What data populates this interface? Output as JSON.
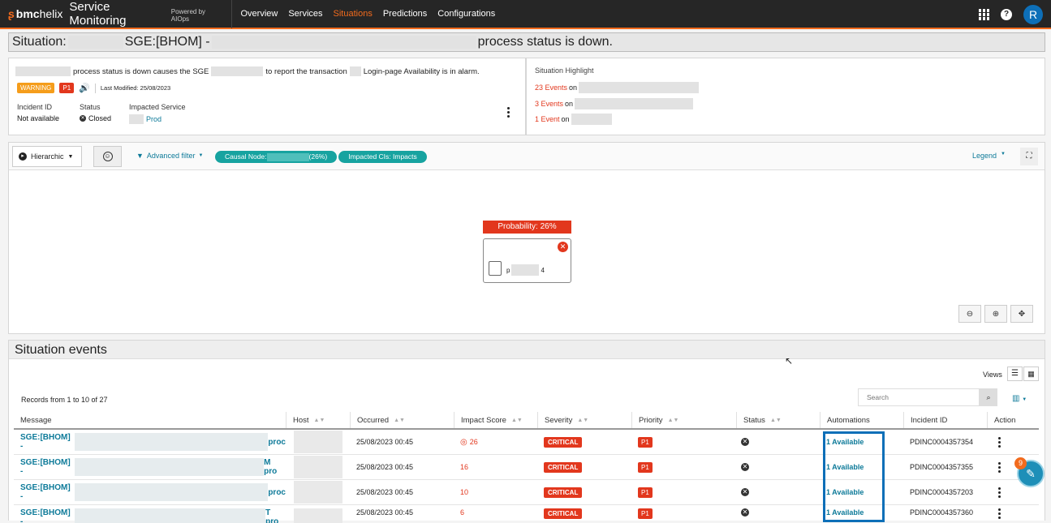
{
  "nav": {
    "brand_logo": "bmc",
    "brand_name": "helix",
    "product": "Service Monitoring",
    "powered": "Powered by AIOps",
    "items": [
      "Overview",
      "Services",
      "Situations",
      "Predictions",
      "Configurations"
    ],
    "active": "Situations",
    "avatar_initial": "R",
    "help": "?"
  },
  "situation": {
    "title_prefix": "Situation:",
    "title_mid": "SGE:[BHOM] -",
    "title_suffix": "process status is down.",
    "description_a": "process status is down causes the SGE",
    "description_b": "to report the transaction",
    "description_c": "Login-page Availability is in alarm.",
    "severity": "WARNING",
    "priority": "P1",
    "last_modified": "Last Modified: 25/08/2023",
    "incident_id_label": "Incident ID",
    "incident_id_value": "Not available",
    "status_label": "Status",
    "status_value": "Closed",
    "impacted_label": "Impacted Service",
    "impacted_value": "Prod"
  },
  "highlight": {
    "title": "Situation Highlight",
    "items": [
      {
        "count": "23 Events",
        "suffix": "on"
      },
      {
        "count": "3 Events",
        "suffix": "on"
      },
      {
        "count": "1 Event",
        "suffix": "on"
      }
    ]
  },
  "graph": {
    "view": "Hierarchic",
    "filter": "Advanced filter",
    "chip1_a": "Causal Node:",
    "chip1_b": "(26%)",
    "chip2": "Impacted CIs: Impacts",
    "legend": "Legend",
    "probability": "Probability: 26%",
    "node_a": "p",
    "node_b": "4"
  },
  "events": {
    "title": "Situation events",
    "views_label": "Views",
    "records": "Records from 1 to 10 of 27",
    "search_placeholder": "Search",
    "columns": [
      "Message",
      "Host",
      "Occurred",
      "Impact Score",
      "Severity",
      "Priority",
      "Status",
      "Automations",
      "Incident ID",
      "Action"
    ],
    "rows": [
      {
        "msg": "SGE:[BHOM] -",
        "msg_tail": "proc",
        "occurred": "25/08/2023 00:45",
        "score": "26",
        "severity": "CRITICAL",
        "priority": "P1",
        "automation": "1 Available",
        "incident": "PDINC0004357354"
      },
      {
        "msg": "SGE:[BHOM] -",
        "msg_tail": "M pro",
        "occurred": "25/08/2023 00:45",
        "score": "16",
        "severity": "CRITICAL",
        "priority": "P1",
        "automation": "1 Available",
        "incident": "PDINC0004357355"
      },
      {
        "msg": "SGE:[BHOM] -",
        "msg_tail": "proc",
        "occurred": "25/08/2023 00:45",
        "score": "10",
        "severity": "CRITICAL",
        "priority": "P1",
        "automation": "1 Available",
        "incident": "PDINC0004357203"
      },
      {
        "msg": "SGE:[BHOM] -",
        "msg_tail": "T pro",
        "occurred": "25/08/2023 00:45",
        "score": "6",
        "severity": "CRITICAL",
        "priority": "P1",
        "automation": "1 Available",
        "incident": "PDINC0004357360"
      }
    ]
  },
  "chat_badge": "9",
  "colors": {
    "accent": "#f26b1d",
    "link": "#0d7a99",
    "critical": "#e2371d",
    "chip": "#17a3a0",
    "highlight_box": "#0d6fb8"
  }
}
